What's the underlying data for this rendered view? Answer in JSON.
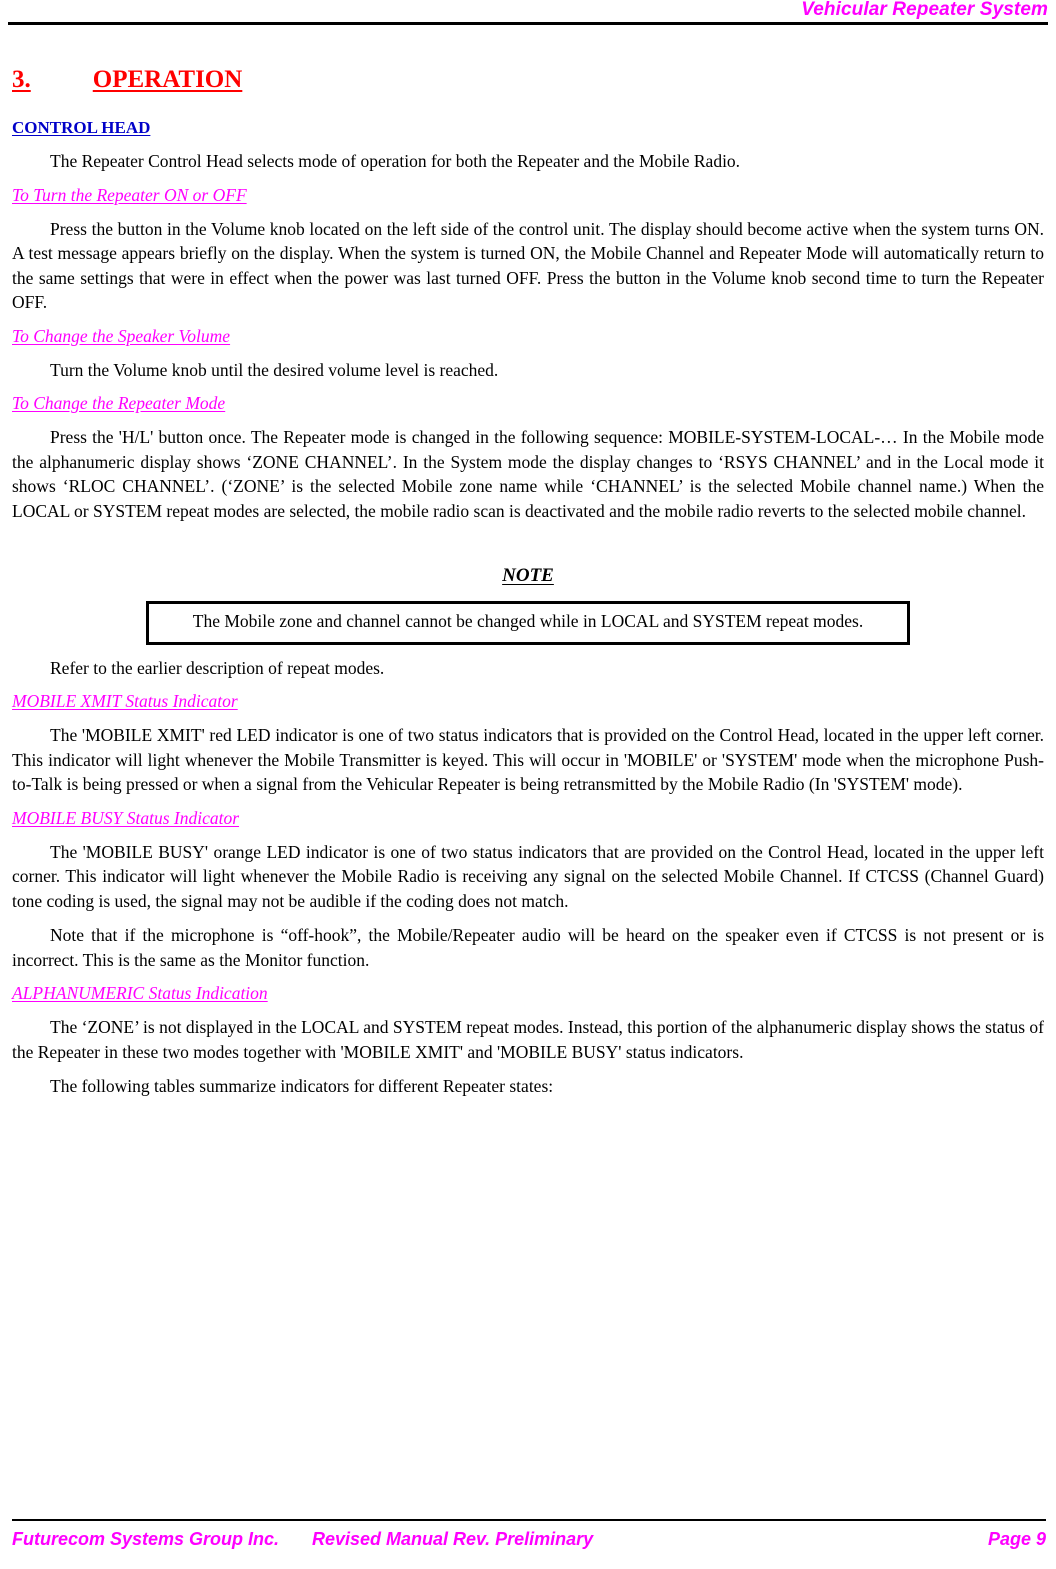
{
  "header": {
    "title": "Vehicular Repeater System"
  },
  "section": {
    "number": "3.",
    "title": "OPERATION"
  },
  "control_head": {
    "heading": "CONTROL HEAD",
    "intro": "The Repeater Control Head selects mode of operation for both the Repeater and the Mobile Radio."
  },
  "subsections": {
    "turn_on_off": {
      "heading": "To Turn the Repeater ON or OFF",
      "body": "Press the button in the Volume knob located on the left side of the control unit. The display should become active when the system turns ON. A test message appears briefly on the display. When the system is turned ON, the Mobile Channel and Repeater Mode will automatically return to the same settings that were in effect when the power was last turned OFF. Press the button in the Volume knob second time to turn the Repeater OFF."
    },
    "speaker_volume": {
      "heading": "To Change the Speaker Volume",
      "body": "Turn the Volume knob until the desired volume level is reached."
    },
    "repeater_mode": {
      "heading": "To Change the Repeater Mode",
      "body": "Press the 'H/L' button once. The Repeater mode is changed in the following sequence: MOBILE-SYSTEM-LOCAL-… In the Mobile mode the alphanumeric display shows ‘ZONE CHANNEL’. In the System mode the display changes to ‘RSYS CHANNEL’ and in the Local mode it shows ‘RLOC CHANNEL’. (‘ZONE’ is the selected Mobile zone name while ‘CHANNEL’ is the selected Mobile channel name.) When the LOCAL or SYSTEM repeat modes are selected, the mobile radio scan is deactivated and the mobile radio reverts to the selected mobile channel."
    },
    "mobile_xmit": {
      "heading": "MOBILE XMIT Status Indicator",
      "body": "The 'MOBILE XMIT' red LED indicator is one of two status indicators that is provided on the Control Head, located in the upper left corner. This indicator will light whenever the Mobile Transmitter is keyed. This will occur in 'MOBILE' or 'SYSTEM' mode when the microphone Push-to-Talk is being pressed or when a signal from the Vehicular Repeater is being retransmitted by the Mobile Radio (In 'SYSTEM' mode)."
    },
    "mobile_busy": {
      "heading": "MOBILE BUSY Status Indicator",
      "body": "The 'MOBILE BUSY' orange LED indicator is one of two status indicators that are provided on the Control Head, located in the upper left corner. This indicator will light whenever the Mobile Radio is receiving any signal on the selected Mobile Channel. If CTCSS (Channel Guard) tone coding is used, the signal may not be audible if the coding does not match.",
      "body2": "Note that if the microphone is “off-hook”, the Mobile/Repeater audio will be heard on the speaker even if CTCSS is not present or is incorrect. This is the same as the Monitor function."
    },
    "alphanumeric": {
      "heading": "ALPHANUMERIC Status Indication",
      "body": "The ‘ZONE’ is not displayed in the LOCAL and SYSTEM repeat modes. Instead, this portion of the alphanumeric display shows the status of the Repeater in these two modes together with 'MOBILE XMIT' and  'MOBILE BUSY' status indicators.",
      "body2": "The following tables summarize indicators for different Repeater states:"
    }
  },
  "note": {
    "title": "NOTE",
    "text": "The Mobile zone and channel cannot be changed while in LOCAL and SYSTEM repeat modes."
  },
  "refer": {
    "text": "Refer to the earlier description of repeat modes."
  },
  "footer": {
    "left": "Futurecom Systems Group Inc.",
    "center": "Revised Manual Rev. Preliminary",
    "right": "Page 9"
  },
  "colors": {
    "accent_magenta": "#FF00FF",
    "heading_red": "#FF0000",
    "heading_blue": "#0000C8",
    "rule_black": "#000000"
  }
}
